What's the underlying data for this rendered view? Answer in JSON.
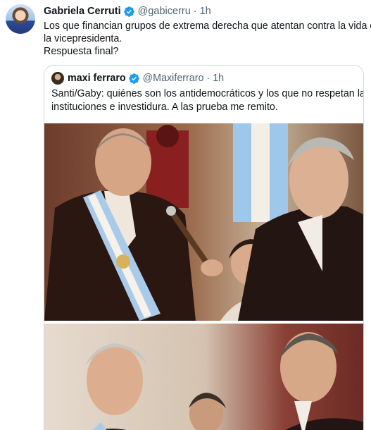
{
  "tweet": {
    "author_name": "Gabriela Cerruti",
    "author_handle": "@gabicerru",
    "separator": "·",
    "time": "1h",
    "text_lines": [
      "Los que financian grupos de extrema derecha que atentan contra la vida de",
      "la vicepresidenta.",
      "Respuesta final?"
    ]
  },
  "quoted_tweet": {
    "author_name": "maxi ferraro",
    "author_handle": "@Maxiferraro",
    "separator": "·",
    "time": "1h",
    "text_lines": [
      "Santi/Gaby: quiénes son los antidemocráticos y los que no respetan las",
      "instituciones e investidura. A las prueba me remito."
    ]
  },
  "icons": {
    "verified": "verified-badge-icon"
  },
  "colors": {
    "text_primary": "#0f1419",
    "text_secondary": "#536471",
    "verified_blue": "#1d9bf0",
    "border": "#cfd9de"
  }
}
